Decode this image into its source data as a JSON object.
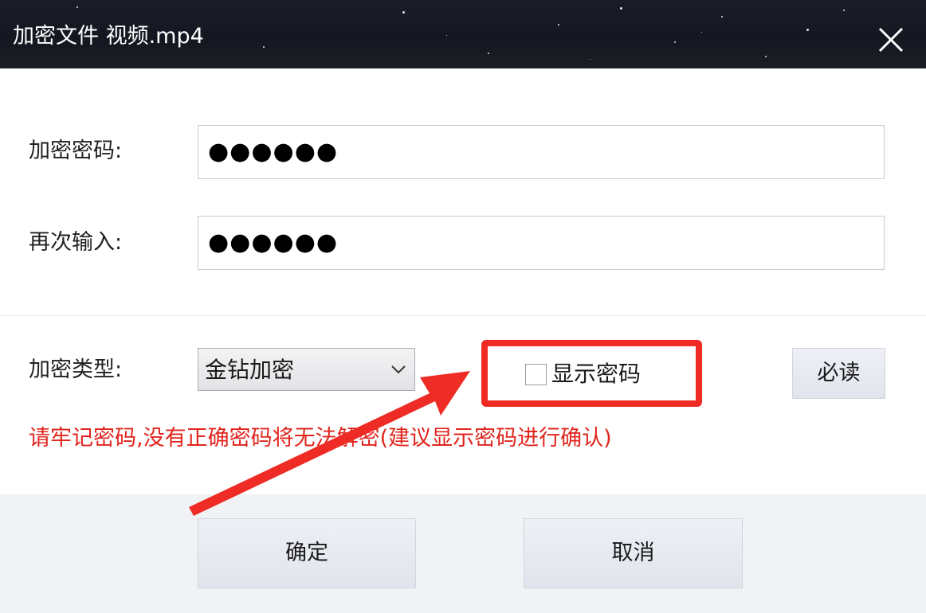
{
  "window": {
    "title": "加密文件 视频.mp4",
    "close_icon": "close-icon"
  },
  "form": {
    "password_label": "加密密码:",
    "password_value": "●●●●●●",
    "confirm_label": "再次输入:",
    "confirm_value": "●●●●●●",
    "type_label": "加密类型:",
    "type_selected": "金钻加密",
    "show_password_label": "显示密码",
    "show_password_checked": false,
    "help_button": "必读",
    "warning_text": "请牢记密码,没有正确密码将无法解密(建议显示密码进行确认)"
  },
  "footer": {
    "ok_button": "确定",
    "cancel_button": "取消"
  },
  "annotation": {
    "color": "#ee2b24",
    "icon": "arrow-icon"
  },
  "colors": {
    "titlebar": "#161922",
    "warning": "#e0241c",
    "highlight": "#ee2b24",
    "button_bg": "#e6e8ef"
  }
}
